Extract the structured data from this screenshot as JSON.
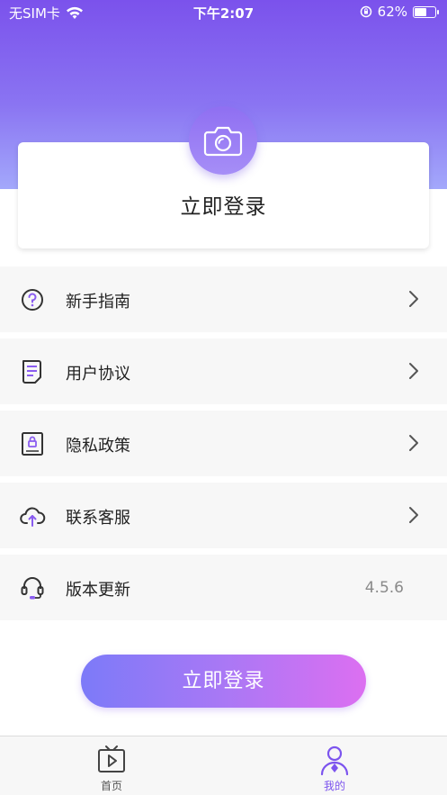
{
  "status_bar": {
    "carrier": "无SIM卡",
    "time": "下午2:07",
    "battery": "62%",
    "battery_level": 0.62
  },
  "login_card": {
    "title": "立即登录"
  },
  "menu": [
    {
      "label": "新手指南",
      "icon": "question-circle-icon",
      "has_arrow": true
    },
    {
      "label": "用户协议",
      "icon": "document-icon",
      "has_arrow": true
    },
    {
      "label": "隐私政策",
      "icon": "lock-document-icon",
      "has_arrow": true
    },
    {
      "label": "联系客服",
      "icon": "cloud-upload-icon",
      "has_arrow": true
    },
    {
      "label": "版本更新",
      "icon": "headset-icon",
      "value": "4.5.6"
    }
  ],
  "login_button": {
    "label": "立即登录"
  },
  "tabs": [
    {
      "label": "首页",
      "icon": "tv-play-icon",
      "active": false
    },
    {
      "label": "我的",
      "icon": "user-icon",
      "active": true
    }
  ],
  "colors": {
    "accent": "#7c54ee",
    "header_top": "#7b52ec",
    "header_bottom": "#a3a8fb",
    "button_left": "#7c7af8",
    "button_right": "#dc6ff1"
  }
}
